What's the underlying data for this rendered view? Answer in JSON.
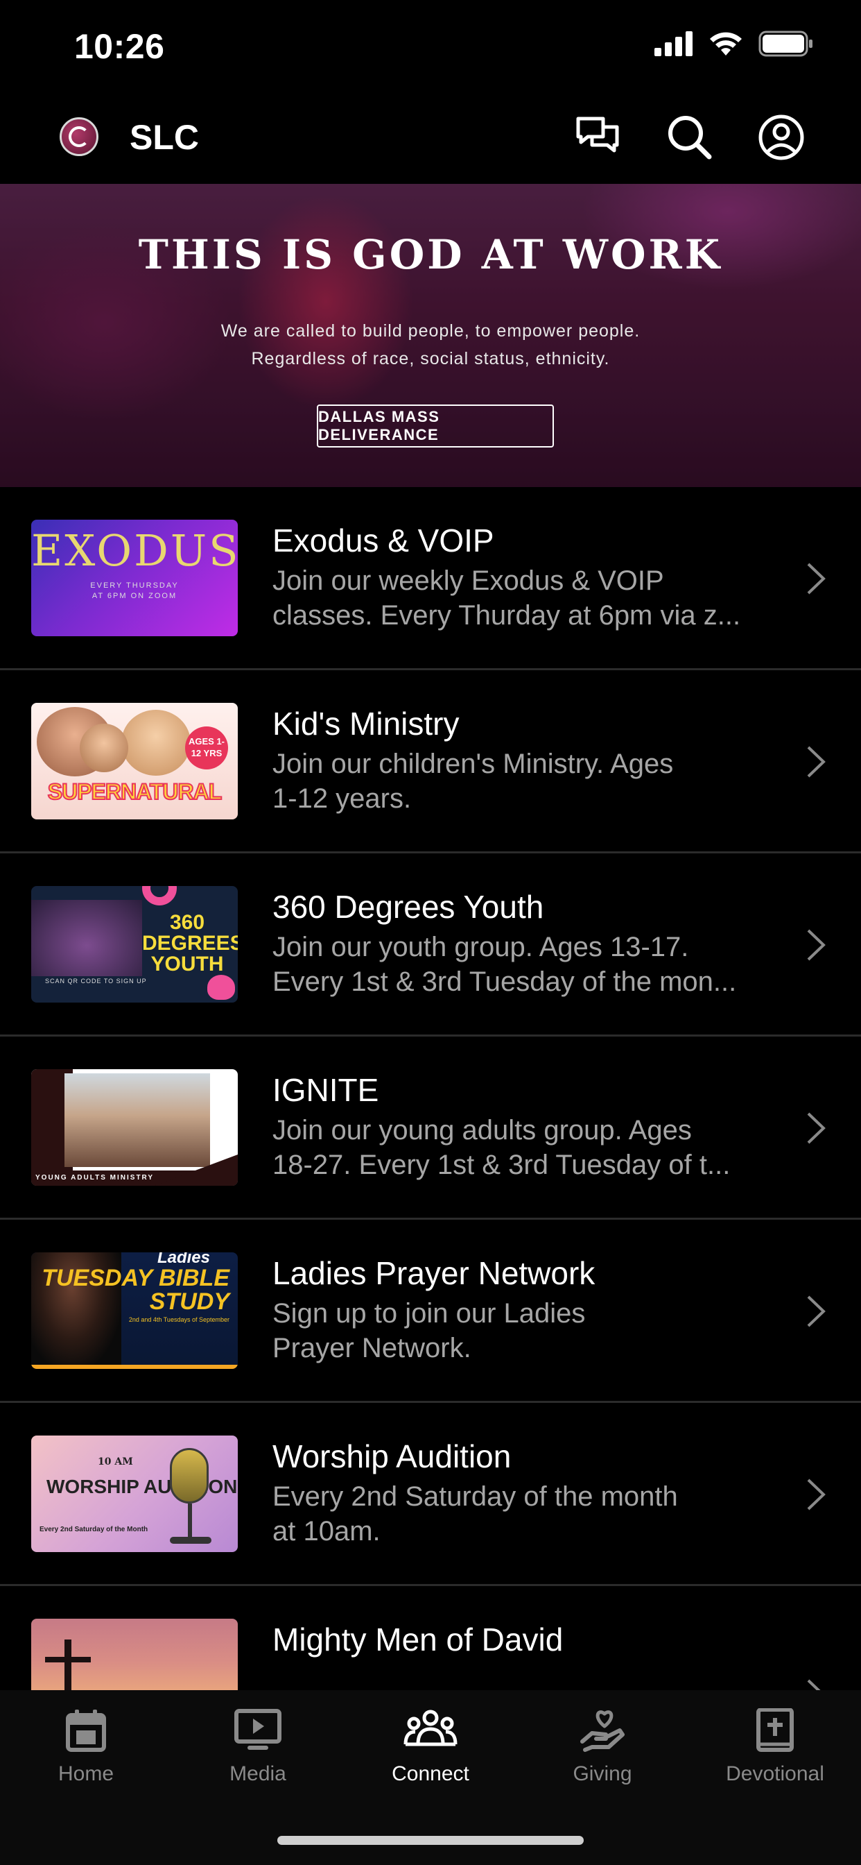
{
  "status_bar": {
    "time": "10:26"
  },
  "header": {
    "app_title": "SLC"
  },
  "hero": {
    "title": "THIS IS GOD AT WORK",
    "subtitle_line1": "We are called to build people, to empower people.",
    "subtitle_line2": "Regardless of race, social status, ethnicity.",
    "button_label": "DALLAS MASS DELIVERANCE"
  },
  "thumb_text": {
    "exodus_big": "EXODUS",
    "exodus_small1": "EVERY THURSDAY",
    "exodus_small2": "AT 6PM ON ZOOM",
    "kids_badge": "AGES 1-12 YRS",
    "kids_word": "SUPERNATURAL",
    "youth_word": "360 DEGREES YOUTH",
    "youth_cap": "SCAN QR CODE TO SIGN UP",
    "ignite_cap": "YOUNG ADULTS MINISTRY",
    "ladies_l1": "Ladies",
    "ladies_l2": "TUESDAY BIBLE STUDY",
    "ladies_l3": "2nd and 4th Tuesdays of September",
    "worship_time": "10 AM",
    "worship_word": "WORSHIP AUDITION",
    "worship_cap": "Every 2nd Saturday of the Month"
  },
  "groups": [
    {
      "title": "Exodus & VOIP",
      "desc_line1": "Join our weekly Exodus & VOIP",
      "desc_line2": "classes. Every Thurday at 6pm via z..."
    },
    {
      "title": "Kid's Ministry",
      "desc_line1": "Join our children's Ministry. Ages",
      "desc_line2": "1-12 years."
    },
    {
      "title": "360 Degrees Youth",
      "desc_line1": "Join our youth group. Ages 13-17.",
      "desc_line2": "Every 1st & 3rd Tuesday of the mon..."
    },
    {
      "title": "IGNITE",
      "desc_line1": "Join our young adults group. Ages",
      "desc_line2": "18-27.  Every 1st & 3rd Tuesday of t..."
    },
    {
      "title": "Ladies Prayer Network",
      "desc_line1": "Sign up to join our Ladies",
      "desc_line2": "Prayer Network."
    },
    {
      "title": "Worship Audition",
      "desc_line1": "Every 2nd Saturday of the month",
      "desc_line2": "at 10am."
    },
    {
      "title": "Mighty Men of David"
    }
  ],
  "tabs": [
    {
      "label": "Home",
      "icon": "calendar-icon"
    },
    {
      "label": "Media",
      "icon": "play-screen-icon"
    },
    {
      "label": "Connect",
      "icon": "people-icon",
      "active": true
    },
    {
      "label": "Giving",
      "icon": "heart-hand-icon"
    },
    {
      "label": "Devotional",
      "icon": "bible-icon"
    }
  ],
  "colors": {
    "background": "#000000",
    "muted_text": "#a6a6a6",
    "divider": "#2b2b2b",
    "tab_inactive": "#8a8a8a"
  }
}
